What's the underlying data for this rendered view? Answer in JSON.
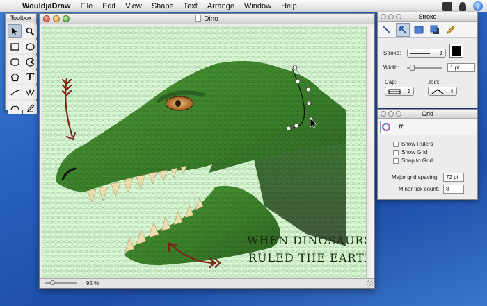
{
  "menubar": {
    "app_name": "WouldjaDraw",
    "items": [
      "File",
      "Edit",
      "View",
      "Shape",
      "Text",
      "Arrange",
      "Window",
      "Help"
    ],
    "right_icons": [
      "monitor-icon",
      "user-icon",
      "spotlight-icon"
    ]
  },
  "toolbox": {
    "title": "Toolbox",
    "tools": [
      "arrow",
      "zoom",
      "rectangle",
      "oval",
      "rounded-rect",
      "pie",
      "polygon",
      "text",
      "line",
      "freehand",
      "bezier",
      "pen"
    ]
  },
  "document": {
    "title": "Dino",
    "caption_line1": "WHEN DINOSAURS",
    "caption_line2": "RULED THE EARTH!",
    "zoom": "95 %",
    "canvas_color": "#d8f7d3"
  },
  "stroke_palette": {
    "title": "Stroke",
    "stroke_label": "Stroke:",
    "width_label": "Width:",
    "width_value": "1 pt",
    "cap_label": "Cap:",
    "join_label": "Join:",
    "color": "#000000"
  },
  "grid_palette": {
    "title": "Grid",
    "show_rulers": "Show Rulers",
    "show_grid": "Show Grid",
    "snap_to_grid": "Snap to Grid",
    "major_label": "Major grid spacing:",
    "major_value": "72 pt",
    "minor_label": "Minor tick count:",
    "minor_value": "8"
  },
  "colors": {
    "dino_green": "#3e8a2e",
    "arrow_red": "#7b2418",
    "caption_text": "#1a2a12"
  }
}
